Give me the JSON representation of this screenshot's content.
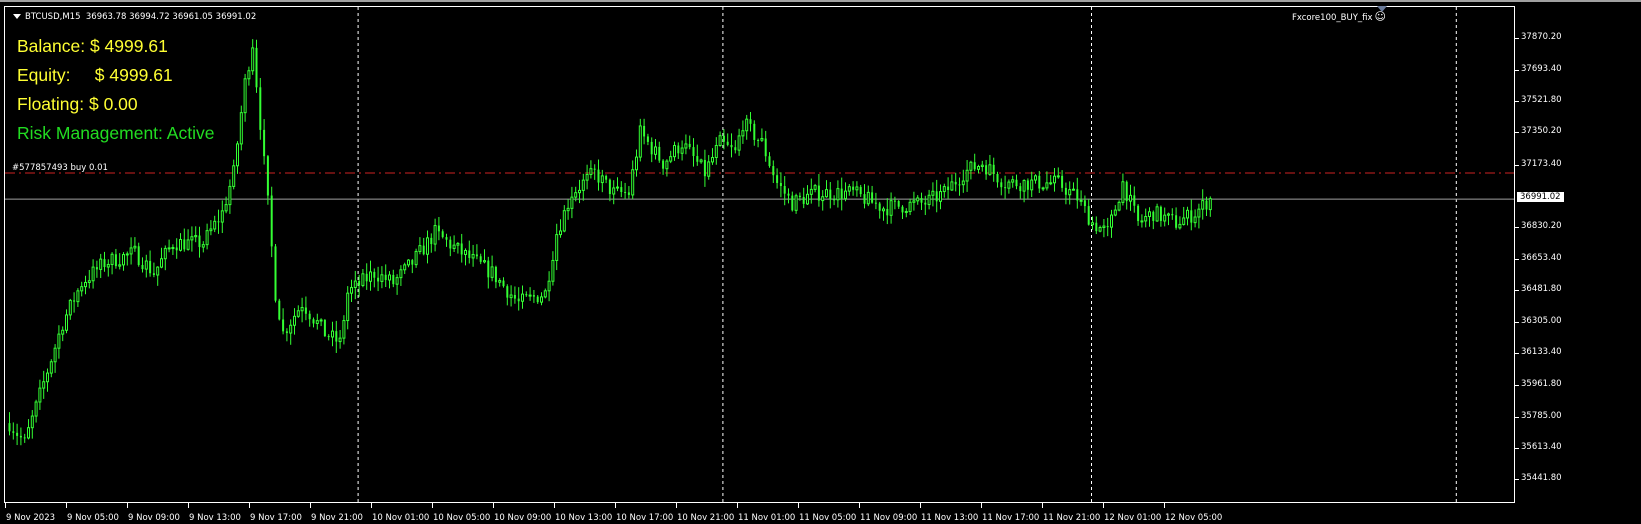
{
  "header": {
    "symbol": "BTCUSD,M15",
    "ohlc": "36963.78 36994.72 36961.05 36991.02"
  },
  "panel": {
    "balance": "Balance: $ 4999.61",
    "equity": "Equity:     $ 4999.61",
    "floating": "Floating: $ 0.00",
    "risk": "Risk Management: Active"
  },
  "order_label": "#577857493 buy 0.01",
  "expert": {
    "name": "Fxcore100_BUY_fix",
    "icon": "smiley-face-icon"
  },
  "colors": {
    "bull": "#33ff33",
    "bear": "#33ff33",
    "order_line": "#cc2222",
    "bid_line": "#a0a0a0",
    "grid": "#ffffff"
  },
  "price_axis": {
    "labels": [
      "37870.20",
      "37693.40",
      "37521.80",
      "37350.20",
      "37173.40",
      "36830.20",
      "36653.40",
      "36481.80",
      "36305.00",
      "36133.40",
      "35961.80",
      "35785.00",
      "35613.40",
      "35441.80"
    ],
    "current": "36991.02",
    "min": 35441.8,
    "max": 37870.2
  },
  "time_axis": {
    "labels": [
      "9 Nov 2023",
      "9 Nov 05:00",
      "9 Nov 09:00",
      "9 Nov 13:00",
      "9 Nov 17:00",
      "9 Nov 21:00",
      "10 Nov 01:00",
      "10 Nov 05:00",
      "10 Nov 09:00",
      "10 Nov 13:00",
      "10 Nov 17:00",
      "10 Nov 21:00",
      "11 Nov 01:00",
      "11 Nov 05:00",
      "11 Nov 09:00",
      "11 Nov 13:00",
      "11 Nov 17:00",
      "11 Nov 21:00",
      "12 Nov 01:00",
      "12 Nov 05:00"
    ]
  },
  "order_price": 37132,
  "bid_price": 36991.02,
  "day_separator_bars": [
    92,
    188,
    285,
    381
  ],
  "chart_data": {
    "type": "candlestick",
    "timeframe": "M15",
    "path": [
      [
        0,
        35755
      ],
      [
        4,
        35645
      ],
      [
        9,
        35976
      ],
      [
        14,
        36306
      ],
      [
        19,
        36526
      ],
      [
        25,
        36637
      ],
      [
        33,
        36692
      ],
      [
        38,
        36582
      ],
      [
        43,
        36747
      ],
      [
        51,
        36747
      ],
      [
        56,
        36912
      ],
      [
        59,
        37132
      ],
      [
        62,
        37628
      ],
      [
        64,
        37848
      ],
      [
        66,
        37408
      ],
      [
        68,
        36967
      ],
      [
        70,
        36471
      ],
      [
        72,
        36251
      ],
      [
        77,
        36416
      ],
      [
        83,
        36251
      ],
      [
        87,
        36196
      ],
      [
        89,
        36471
      ],
      [
        96,
        36582
      ],
      [
        101,
        36526
      ],
      [
        106,
        36637
      ],
      [
        112,
        36802
      ],
      [
        119,
        36692
      ],
      [
        127,
        36582
      ],
      [
        134,
        36416
      ],
      [
        141,
        36471
      ],
      [
        144,
        36802
      ],
      [
        148,
        37022
      ],
      [
        154,
        37132
      ],
      [
        159,
        37022
      ],
      [
        163,
        37022
      ],
      [
        166,
        37352
      ],
      [
        172,
        37187
      ],
      [
        177,
        37297
      ],
      [
        183,
        37132
      ],
      [
        187,
        37297
      ],
      [
        191,
        37242
      ],
      [
        193,
        37408
      ],
      [
        198,
        37297
      ],
      [
        202,
        37077
      ],
      [
        206,
        36967
      ],
      [
        212,
        37022
      ],
      [
        222,
        37022
      ],
      [
        230,
        36940
      ],
      [
        241,
        36967
      ],
      [
        246,
        37022
      ],
      [
        251,
        37132
      ],
      [
        256,
        37187
      ],
      [
        262,
        37077
      ],
      [
        270,
        37077
      ],
      [
        276,
        37077
      ],
      [
        281,
        36995
      ],
      [
        285,
        36857
      ],
      [
        289,
        36802
      ],
      [
        293,
        37077
      ],
      [
        297,
        36857
      ],
      [
        301,
        36912
      ],
      [
        307,
        36857
      ],
      [
        312,
        36912
      ],
      [
        316,
        36991
      ]
    ]
  }
}
